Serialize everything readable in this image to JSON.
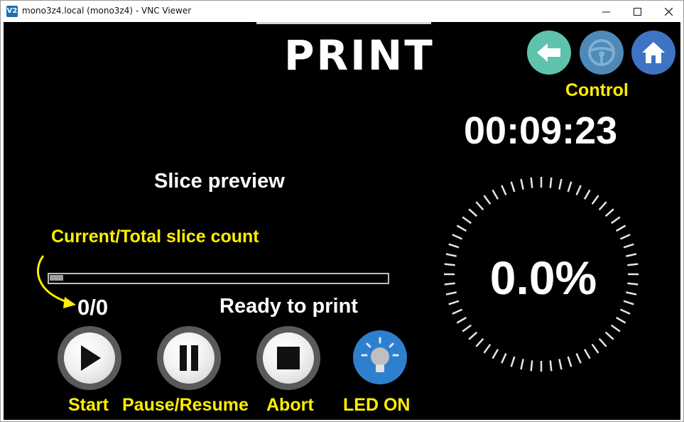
{
  "window": {
    "icon_text": "V2",
    "title": "mono3z4.local (mono3z4) - VNC Viewer",
    "minimize_glyph": "minimize-icon",
    "maximize_glyph": "maximize-icon",
    "close_glyph": "close-icon"
  },
  "header": {
    "title": "PRINT",
    "nav_buttons": [
      {
        "name": "back",
        "icon": "back-arrow-icon",
        "color": "#5fc2ad"
      },
      {
        "name": "control",
        "icon": "steering-wheel-icon",
        "color": "#4e89b8"
      },
      {
        "name": "home",
        "icon": "home-icon",
        "color": "#3f73c4"
      }
    ],
    "control_annotation": "Control"
  },
  "timer": {
    "elapsed": "00:09:23"
  },
  "preview": {
    "label": "Slice preview",
    "slice_count_annotation": "Current/Total slice count",
    "progress_fraction": 0.04,
    "slice_count": "0/0",
    "status": "Ready to print"
  },
  "controls": {
    "start_label": "Start",
    "pause_label": "Pause/Resume",
    "abort_label": "Abort",
    "led_label": "LED ON"
  },
  "dial": {
    "percent": "0.0%",
    "progress": 0.0
  },
  "colors": {
    "annotation": "#ffee00",
    "background": "#000000",
    "text": "#ffffff",
    "led_button": "#2f7fcf"
  }
}
